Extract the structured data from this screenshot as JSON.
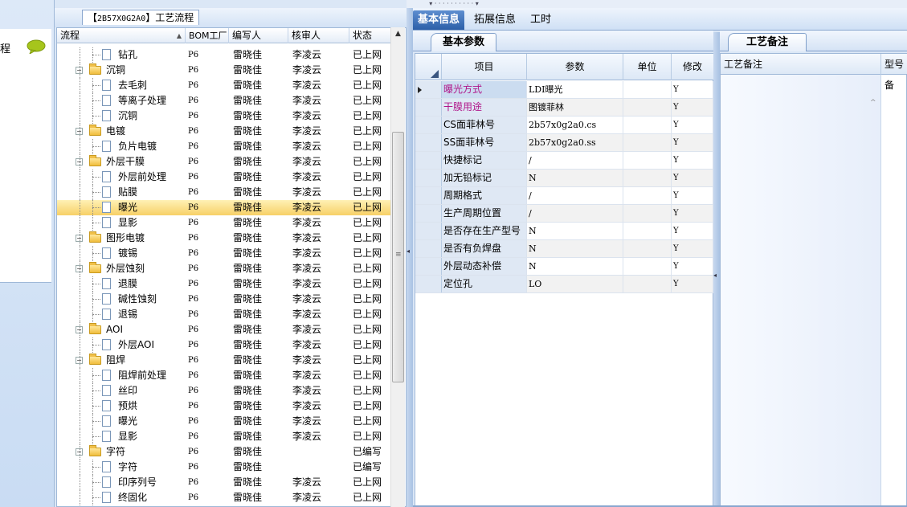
{
  "left_strip": {
    "label": "程"
  },
  "tree_tab": {
    "prefix": "【",
    "code": "2B57X0G2A0",
    "suffix": "】",
    "title": "工艺流程"
  },
  "tree_columns": {
    "flow": "流程",
    "bom": "BOM工厂",
    "writer": "编写人",
    "reviewer": "核审人",
    "status": "状态"
  },
  "tree_rows": [
    {
      "label": "钻孔",
      "level": 1,
      "type": "doc",
      "bom": "P6",
      "writer": "雷晓佳",
      "reviewer": "李凌云",
      "status": "已上网"
    },
    {
      "label": "沉铜",
      "level": 0,
      "type": "folder",
      "bom": "P6",
      "writer": "雷晓佳",
      "reviewer": "李凌云",
      "status": "已上网"
    },
    {
      "label": "去毛刺",
      "level": 1,
      "type": "doc",
      "bom": "P6",
      "writer": "雷晓佳",
      "reviewer": "李凌云",
      "status": "已上网"
    },
    {
      "label": "等离子处理",
      "level": 1,
      "type": "doc",
      "bom": "P6",
      "writer": "雷晓佳",
      "reviewer": "李凌云",
      "status": "已上网"
    },
    {
      "label": "沉铜",
      "level": 1,
      "type": "doc",
      "bom": "P6",
      "writer": "雷晓佳",
      "reviewer": "李凌云",
      "status": "已上网"
    },
    {
      "label": "电镀",
      "level": 0,
      "type": "folder",
      "bom": "P6",
      "writer": "雷晓佳",
      "reviewer": "李凌云",
      "status": "已上网"
    },
    {
      "label": "负片电镀",
      "level": 1,
      "type": "doc",
      "bom": "P6",
      "writer": "雷晓佳",
      "reviewer": "李凌云",
      "status": "已上网"
    },
    {
      "label": "外层干膜",
      "level": 0,
      "type": "folder",
      "bom": "P6",
      "writer": "雷晓佳",
      "reviewer": "李凌云",
      "status": "已上网"
    },
    {
      "label": "外层前处理",
      "level": 1,
      "type": "doc",
      "bom": "P6",
      "writer": "雷晓佳",
      "reviewer": "李凌云",
      "status": "已上网"
    },
    {
      "label": "贴膜",
      "level": 1,
      "type": "doc",
      "bom": "P6",
      "writer": "雷晓佳",
      "reviewer": "李凌云",
      "status": "已上网"
    },
    {
      "label": "曝光",
      "level": 1,
      "type": "doc",
      "bom": "P6",
      "writer": "雷晓佳",
      "reviewer": "李凌云",
      "status": "已上网",
      "selected": true
    },
    {
      "label": "显影",
      "level": 1,
      "type": "doc",
      "bom": "P6",
      "writer": "雷晓佳",
      "reviewer": "李凌云",
      "status": "已上网"
    },
    {
      "label": "图形电镀",
      "level": 0,
      "type": "folder",
      "bom": "P6",
      "writer": "雷晓佳",
      "reviewer": "李凌云",
      "status": "已上网"
    },
    {
      "label": "镀锡",
      "level": 1,
      "type": "doc",
      "bom": "P6",
      "writer": "雷晓佳",
      "reviewer": "李凌云",
      "status": "已上网"
    },
    {
      "label": "外层蚀刻",
      "level": 0,
      "type": "folder",
      "bom": "P6",
      "writer": "雷晓佳",
      "reviewer": "李凌云",
      "status": "已上网"
    },
    {
      "label": "退膜",
      "level": 1,
      "type": "doc",
      "bom": "P6",
      "writer": "雷晓佳",
      "reviewer": "李凌云",
      "status": "已上网"
    },
    {
      "label": "碱性蚀刻",
      "level": 1,
      "type": "doc",
      "bom": "P6",
      "writer": "雷晓佳",
      "reviewer": "李凌云",
      "status": "已上网"
    },
    {
      "label": "退锡",
      "level": 1,
      "type": "doc",
      "bom": "P6",
      "writer": "雷晓佳",
      "reviewer": "李凌云",
      "status": "已上网"
    },
    {
      "label": "AOI",
      "level": 0,
      "type": "folder",
      "bom": "P6",
      "writer": "雷晓佳",
      "reviewer": "李凌云",
      "status": "已上网"
    },
    {
      "label": "外层AOI",
      "level": 1,
      "type": "doc",
      "bom": "P6",
      "writer": "雷晓佳",
      "reviewer": "李凌云",
      "status": "已上网"
    },
    {
      "label": "阻焊",
      "level": 0,
      "type": "folder",
      "bom": "P6",
      "writer": "雷晓佳",
      "reviewer": "李凌云",
      "status": "已上网"
    },
    {
      "label": "阻焊前处理",
      "level": 1,
      "type": "doc",
      "bom": "P6",
      "writer": "雷晓佳",
      "reviewer": "李凌云",
      "status": "已上网"
    },
    {
      "label": "丝印",
      "level": 1,
      "type": "doc",
      "bom": "P6",
      "writer": "雷晓佳",
      "reviewer": "李凌云",
      "status": "已上网"
    },
    {
      "label": "预烘",
      "level": 1,
      "type": "doc",
      "bom": "P6",
      "writer": "雷晓佳",
      "reviewer": "李凌云",
      "status": "已上网"
    },
    {
      "label": "曝光",
      "level": 1,
      "type": "doc",
      "bom": "P6",
      "writer": "雷晓佳",
      "reviewer": "李凌云",
      "status": "已上网"
    },
    {
      "label": "显影",
      "level": 1,
      "type": "doc",
      "bom": "P6",
      "writer": "雷晓佳",
      "reviewer": "李凌云",
      "status": "已上网"
    },
    {
      "label": "字符",
      "level": 0,
      "type": "folder",
      "bom": "P6",
      "writer": "雷晓佳",
      "reviewer": "",
      "status": "已编写"
    },
    {
      "label": "字符",
      "level": 1,
      "type": "doc",
      "bom": "P6",
      "writer": "雷晓佳",
      "reviewer": "",
      "status": "已编写"
    },
    {
      "label": "印序列号",
      "level": 1,
      "type": "doc",
      "bom": "P6",
      "writer": "雷晓佳",
      "reviewer": "李凌云",
      "status": "已上网"
    },
    {
      "label": "终固化",
      "level": 1,
      "type": "doc",
      "bom": "P6",
      "writer": "雷晓佳",
      "reviewer": "李凌云",
      "status": "已上网"
    }
  ],
  "main_tabs": [
    "基本信息",
    "拓展信息",
    "工时"
  ],
  "params_tab": "基本参数",
  "params_columns": {
    "item": "项目",
    "param": "参数",
    "unit": "单位",
    "edit": "修改"
  },
  "params_rows": [
    {
      "item": "曝光方式",
      "value": "LDI曝光",
      "unit": "",
      "edit": "Y",
      "highlight": true,
      "current": true
    },
    {
      "item": "干膜用途",
      "value": "图镀菲林",
      "unit": "",
      "edit": "Y",
      "highlight": true
    },
    {
      "item": "CS面菲林号",
      "value": "2b57x0g2a0.cs",
      "unit": "",
      "edit": "Y"
    },
    {
      "item": "SS面菲林号",
      "value": "2b57x0g2a0.ss",
      "unit": "",
      "edit": "Y"
    },
    {
      "item": "快捷标记",
      "value": "/",
      "unit": "",
      "edit": "Y"
    },
    {
      "item": "加无铅标记",
      "value": "N",
      "unit": "",
      "edit": "Y"
    },
    {
      "item": "周期格式",
      "value": "/",
      "unit": "",
      "edit": "Y"
    },
    {
      "item": "生产周期位置",
      "value": "/",
      "unit": "",
      "edit": "Y"
    },
    {
      "item": "是否存在生产型号",
      "value": "N",
      "unit": "",
      "edit": "Y"
    },
    {
      "item": "是否有负焊盘",
      "value": "N",
      "unit": "",
      "edit": "Y"
    },
    {
      "item": "外层动态补偿",
      "value": "N",
      "unit": "",
      "edit": "Y"
    },
    {
      "item": "定位孔",
      "value": "LO",
      "unit": "",
      "edit": "Y"
    }
  ],
  "notes_tab": "工艺备注",
  "notes_columns": {
    "note": "工艺备注",
    "model": "型号备"
  },
  "colors": {
    "highlight_text": "#b0178a",
    "selection": "#f7d067",
    "accent": "#2c5fa8"
  }
}
